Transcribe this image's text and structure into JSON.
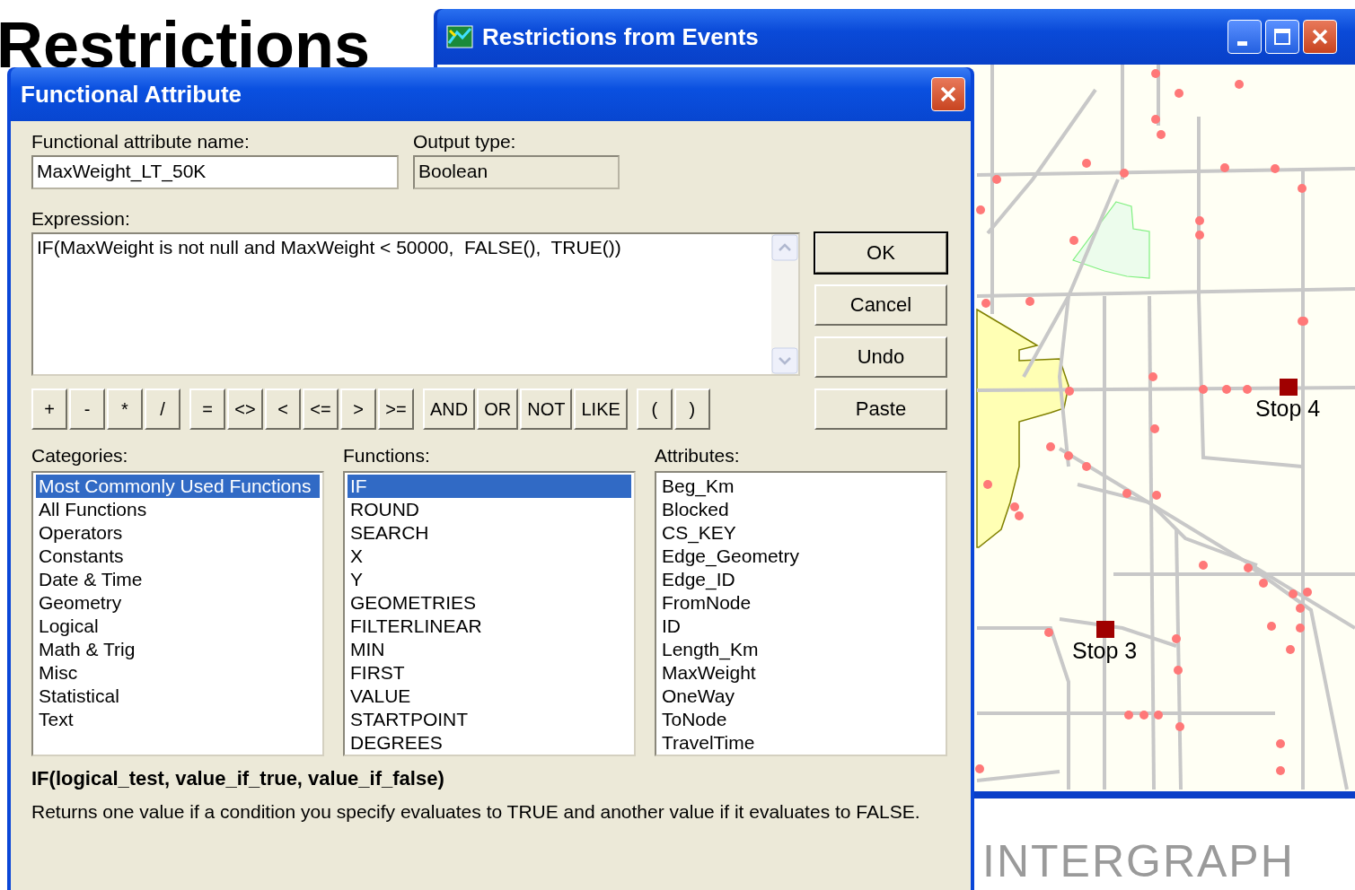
{
  "slide": {
    "title": "Restrictions",
    "logo": "INTERGRAPH"
  },
  "map_window": {
    "title": "Restrictions from Events",
    "stops": [
      {
        "label": "Stop 4"
      },
      {
        "label": "Stop 3"
      }
    ]
  },
  "dialog": {
    "title": "Functional Attribute",
    "name_label": "Functional attribute name:",
    "name_value": "MaxWeight_LT_50K",
    "output_label": "Output type:",
    "output_value": "Boolean",
    "expression_label": "Expression:",
    "expression_value": "IF(MaxWeight is not null and MaxWeight < 50000,  FALSE(),  TRUE())",
    "operator_groups": [
      [
        "+",
        "-",
        "*",
        "/"
      ],
      [
        "=",
        "<>",
        "<",
        "<=",
        ">",
        ">="
      ],
      [
        "AND",
        "OR",
        "NOT",
        "LIKE"
      ],
      [
        "(",
        ")"
      ]
    ],
    "side_buttons": [
      {
        "label": "OK",
        "default": true
      },
      {
        "label": "Cancel",
        "default": false
      },
      {
        "label": "Undo",
        "default": false
      },
      {
        "label": "Paste",
        "default": false
      }
    ],
    "lists": [
      {
        "label": "Categories:",
        "items": [
          {
            "text": "Most Commonly Used Functions",
            "selected": true
          },
          {
            "text": "All Functions",
            "selected": false
          },
          {
            "text": "Operators",
            "selected": false
          },
          {
            "text": "Constants",
            "selected": false
          },
          {
            "text": "Date & Time",
            "selected": false
          },
          {
            "text": "Geometry",
            "selected": false
          },
          {
            "text": "Logical",
            "selected": false
          },
          {
            "text": "Math & Trig",
            "selected": false
          },
          {
            "text": "Misc",
            "selected": false
          },
          {
            "text": "Statistical",
            "selected": false
          },
          {
            "text": "Text",
            "selected": false
          }
        ]
      },
      {
        "label": "Functions:",
        "items": [
          {
            "text": "IF",
            "selected": true
          },
          {
            "text": "ROUND",
            "selected": false
          },
          {
            "text": "SEARCH",
            "selected": false
          },
          {
            "text": "X",
            "selected": false
          },
          {
            "text": "Y",
            "selected": false
          },
          {
            "text": "GEOMETRIES",
            "selected": false
          },
          {
            "text": "FILTERLINEAR",
            "selected": false
          },
          {
            "text": "MIN",
            "selected": false
          },
          {
            "text": "FIRST",
            "selected": false
          },
          {
            "text": "VALUE",
            "selected": false
          },
          {
            "text": "STARTPOINT",
            "selected": false
          },
          {
            "text": "DEGREES",
            "selected": false
          }
        ]
      },
      {
        "label": "Attributes:",
        "items": [
          {
            "text": "Beg_Km",
            "selected": false
          },
          {
            "text": "Blocked",
            "selected": false
          },
          {
            "text": "CS_KEY",
            "selected": false
          },
          {
            "text": "Edge_Geometry",
            "selected": false
          },
          {
            "text": "Edge_ID",
            "selected": false
          },
          {
            "text": "FromNode",
            "selected": false
          },
          {
            "text": "ID",
            "selected": false
          },
          {
            "text": "Length_Km",
            "selected": false
          },
          {
            "text": "MaxWeight",
            "selected": false
          },
          {
            "text": "OneWay",
            "selected": false
          },
          {
            "text": "ToNode",
            "selected": false
          },
          {
            "text": "TravelTime",
            "selected": false
          }
        ]
      }
    ],
    "syntax": "IF(logical_test, value_if_true, value_if_false)",
    "description": "Returns one value if a condition you specify evaluates to TRUE and another value if it evaluates to FALSE."
  }
}
